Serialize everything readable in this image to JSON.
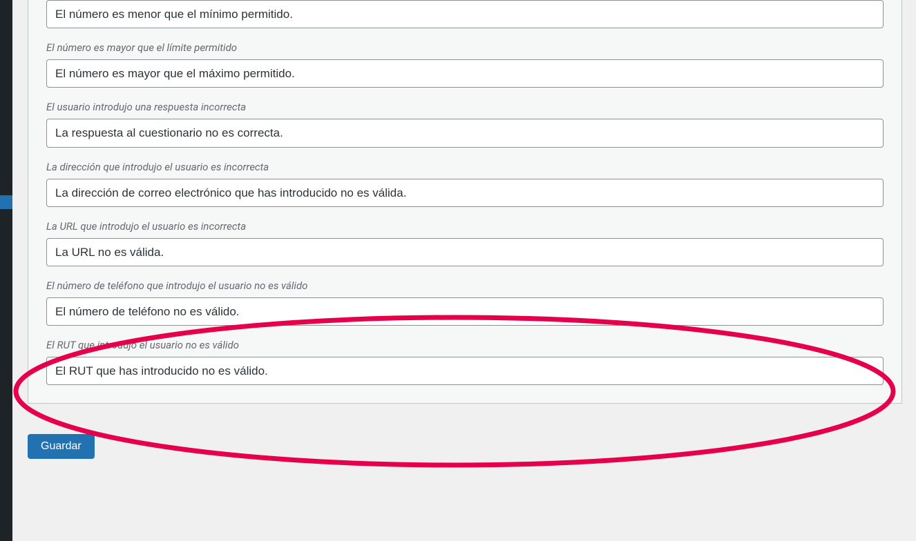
{
  "fields": [
    {
      "label": "",
      "value": "El número es menor que el mínimo permitido."
    },
    {
      "label": "El número es mayor que el límite permitido",
      "value": "El número es mayor que el máximo permitido."
    },
    {
      "label": "El usuario introdujo una respuesta incorrecta",
      "value": "La respuesta al cuestionario no es correcta."
    },
    {
      "label": "La dirección que introdujo el usuario es incorrecta",
      "value": "La dirección de correo electrónico que has introducido no es válida."
    },
    {
      "label": "La URL que introdujo el usuario es incorrecta",
      "value": "La URL no es válida."
    },
    {
      "label": "El número de teléfono que introdujo el usuario no es válido",
      "value": "El número de teléfono no es válido."
    },
    {
      "label": "El RUT que introdujo el usuario no es válido",
      "value": "El RUT que has introducido no es válido."
    }
  ],
  "buttons": {
    "save": "Guardar"
  },
  "annotation": {
    "highlight_index": 6
  }
}
